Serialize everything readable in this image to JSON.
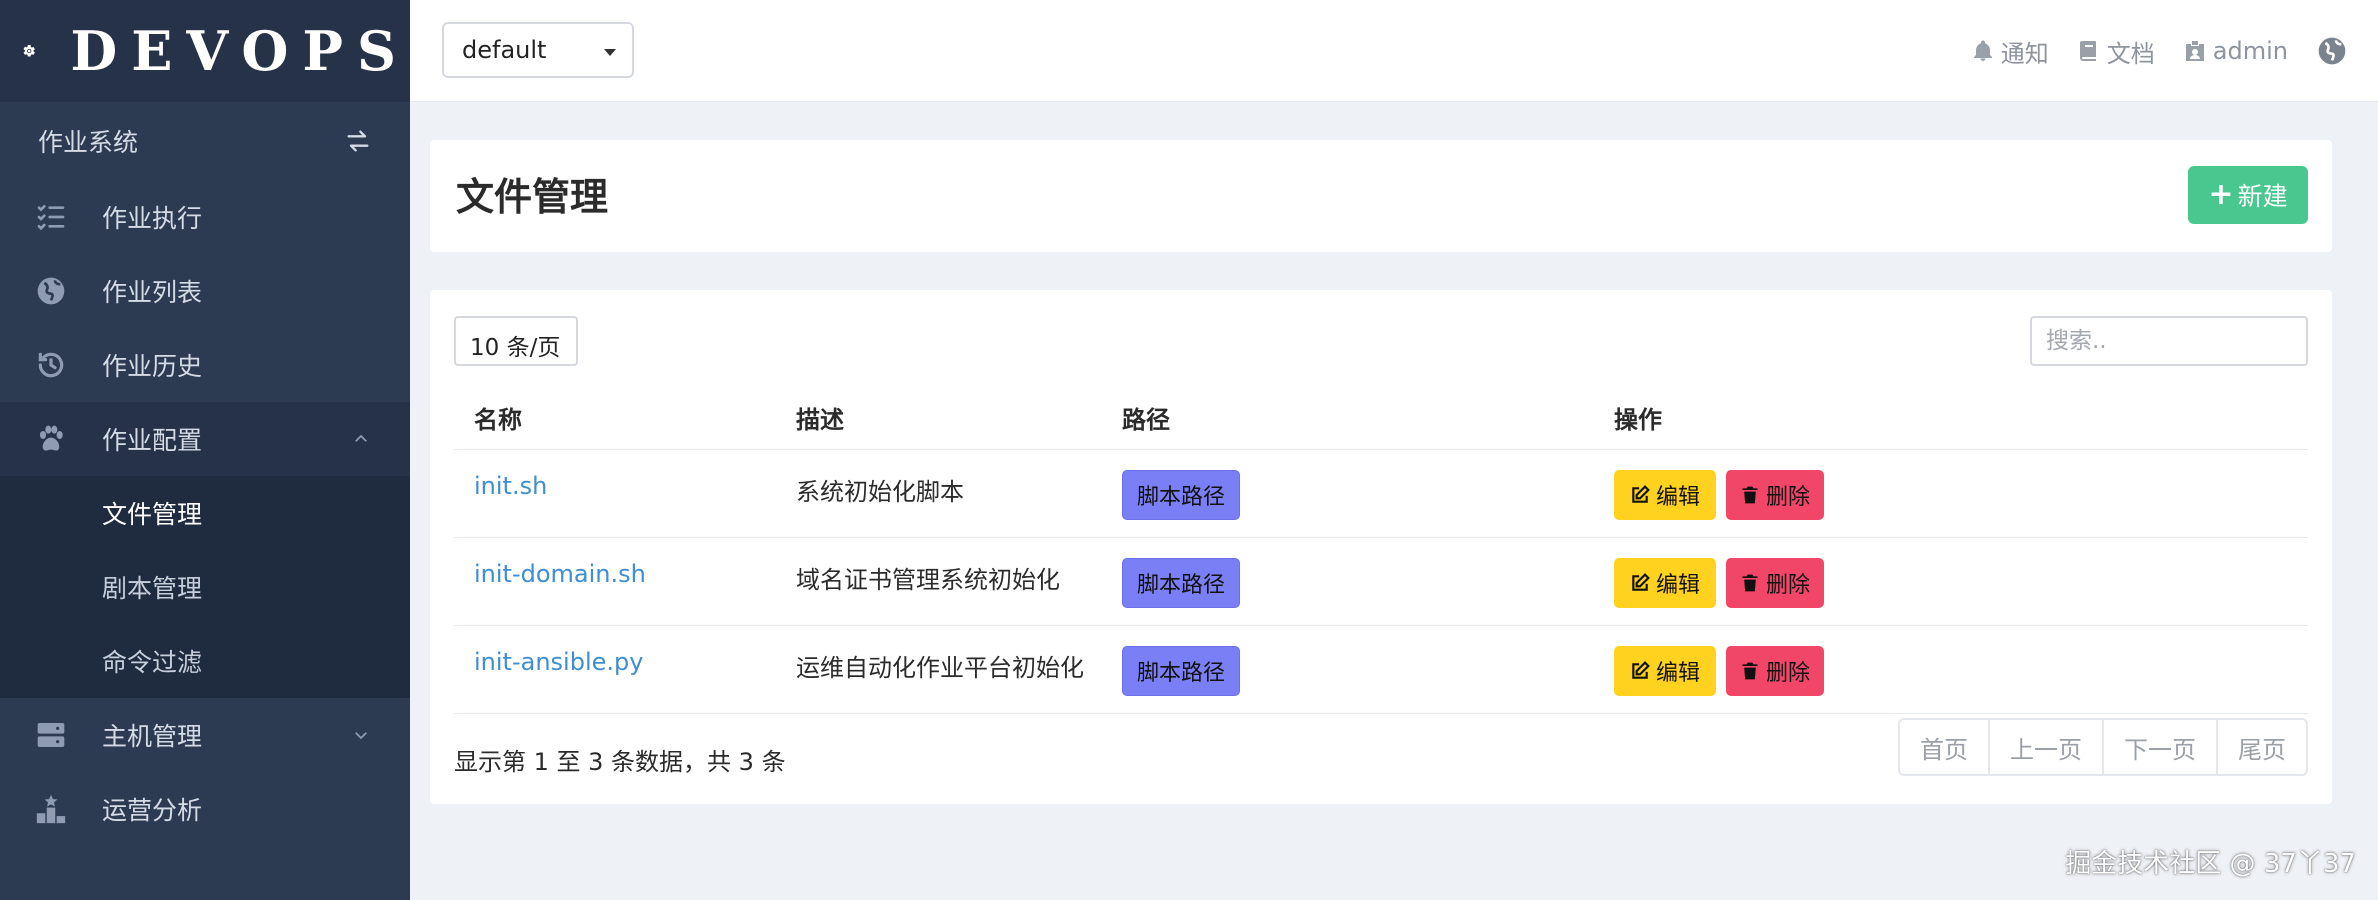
{
  "brand": {
    "title": "DEVOPS"
  },
  "sidebar": {
    "section_label": "作业系统",
    "items": [
      {
        "label": "作业执行",
        "icon": "tasks-icon"
      },
      {
        "label": "作业列表",
        "icon": "globe-icon"
      },
      {
        "label": "作业历史",
        "icon": "history-icon"
      },
      {
        "label": "作业配置",
        "icon": "paw-icon",
        "expanded": true,
        "children": [
          {
            "label": "文件管理",
            "active": true
          },
          {
            "label": "剧本管理"
          },
          {
            "label": "命令过滤"
          }
        ]
      },
      {
        "label": "主机管理",
        "icon": "server-icon"
      },
      {
        "label": "运营分析",
        "icon": "chart-icon"
      }
    ]
  },
  "topbar": {
    "namespace_value": "default",
    "notify_label": "通知",
    "docs_label": "文档",
    "user_label": "admin"
  },
  "page": {
    "title": "文件管理",
    "new_button": "新建"
  },
  "table": {
    "per_page": "10 条/页",
    "search_placeholder": "搜索..",
    "columns": [
      "名称",
      "描述",
      "路径",
      "操作"
    ],
    "rows": [
      {
        "name": "init.sh",
        "desc": "系统初始化脚本",
        "path_tag": "脚本路径",
        "edit": "编辑",
        "delete": "删除"
      },
      {
        "name": "init-domain.sh",
        "desc": "域名证书管理系统初始化",
        "path_tag": "脚本路径",
        "edit": "编辑",
        "delete": "删除"
      },
      {
        "name": "init-ansible.py",
        "desc": "运维自动化作业平台初始化",
        "path_tag": "脚本路径",
        "edit": "编辑",
        "delete": "删除"
      }
    ],
    "summary": "显示第 1 至 3 条数据，共 3 条",
    "pager": [
      "首页",
      "上一页",
      "下一页",
      "尾页"
    ]
  },
  "watermark": "掘金技术社区 @ 37丫37",
  "colors": {
    "sidebar_bg": "#2c3a52",
    "primary_green": "#48c78e",
    "link_blue": "#3e8ed0",
    "tag_purple": "#7b7ff5",
    "edit_yellow": "#ffd21f",
    "delete_red": "#f14668"
  }
}
